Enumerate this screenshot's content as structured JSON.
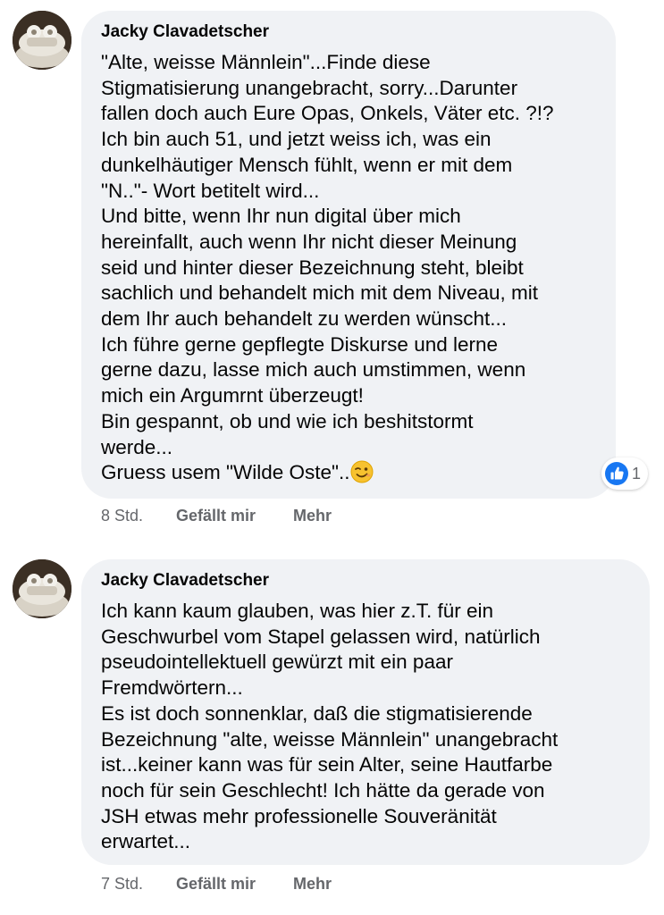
{
  "comments": [
    {
      "author": "Jacky Clavadetscher",
      "text": "\"Alte, weisse Männlein\"...Finde diese\nStigmatisierung unangebracht, sorry...Darunter\nfallen doch auch Eure Opas, Onkels, Väter etc. ?!?\nIch bin auch 51, und jetzt weiss ich, was ein\ndunkelhäutiger Mensch fühlt, wenn er mit dem\n\"N..\"- Wort betitelt wird...\nUnd bitte, wenn Ihr nun digital über mich\nhereinfallt, auch wenn Ihr nicht dieser Meinung\nseid und hinter dieser Bezeichnung steht, bleibt\nsachlich und behandelt mich mit dem Niveau, mit\ndem Ihr auch behandelt zu werden wünscht...\nIch führe gerne gepflegte Diskurse und lerne\ngerne dazu, lasse mich auch umstimmen, wenn\nmich ein Argumrnt überzeugt!\nBin gespannt, ob und wie ich beshitstormt\nwerde...\nGruess usem \"Wilde Oste\"..",
      "emoji": "winking-face-emoji",
      "reaction_icon": "thumbs-up-icon",
      "reaction_count": "1",
      "time": "8 Std.",
      "like_label": "Gefällt mir",
      "more_label": "Mehr"
    },
    {
      "author": "Jacky Clavadetscher",
      "text": "Ich kann kaum glauben, was hier z.T. für ein\nGeschwurbel vom Stapel gelassen wird, natürlich\npseudointellektuell gewürzt mit ein paar\nFremdwörtern...\nEs ist doch sonnenklar, daß die stigmatisierende\nBezeichnung \"alte, weisse Männlein\" unangebracht\nist...keiner kann was für sein Alter, seine Hautfarbe\nnoch für sein Geschlecht! Ich hätte da gerade von\nJSH etwas mehr professionelle Souveränität\nerwartet...",
      "time": "7 Std.",
      "like_label": "Gefällt mir",
      "more_label": "Mehr"
    }
  ],
  "colors": {
    "bubble": "#f0f2f5",
    "meta_text": "#65676b",
    "like_blue": "#1877f2"
  }
}
